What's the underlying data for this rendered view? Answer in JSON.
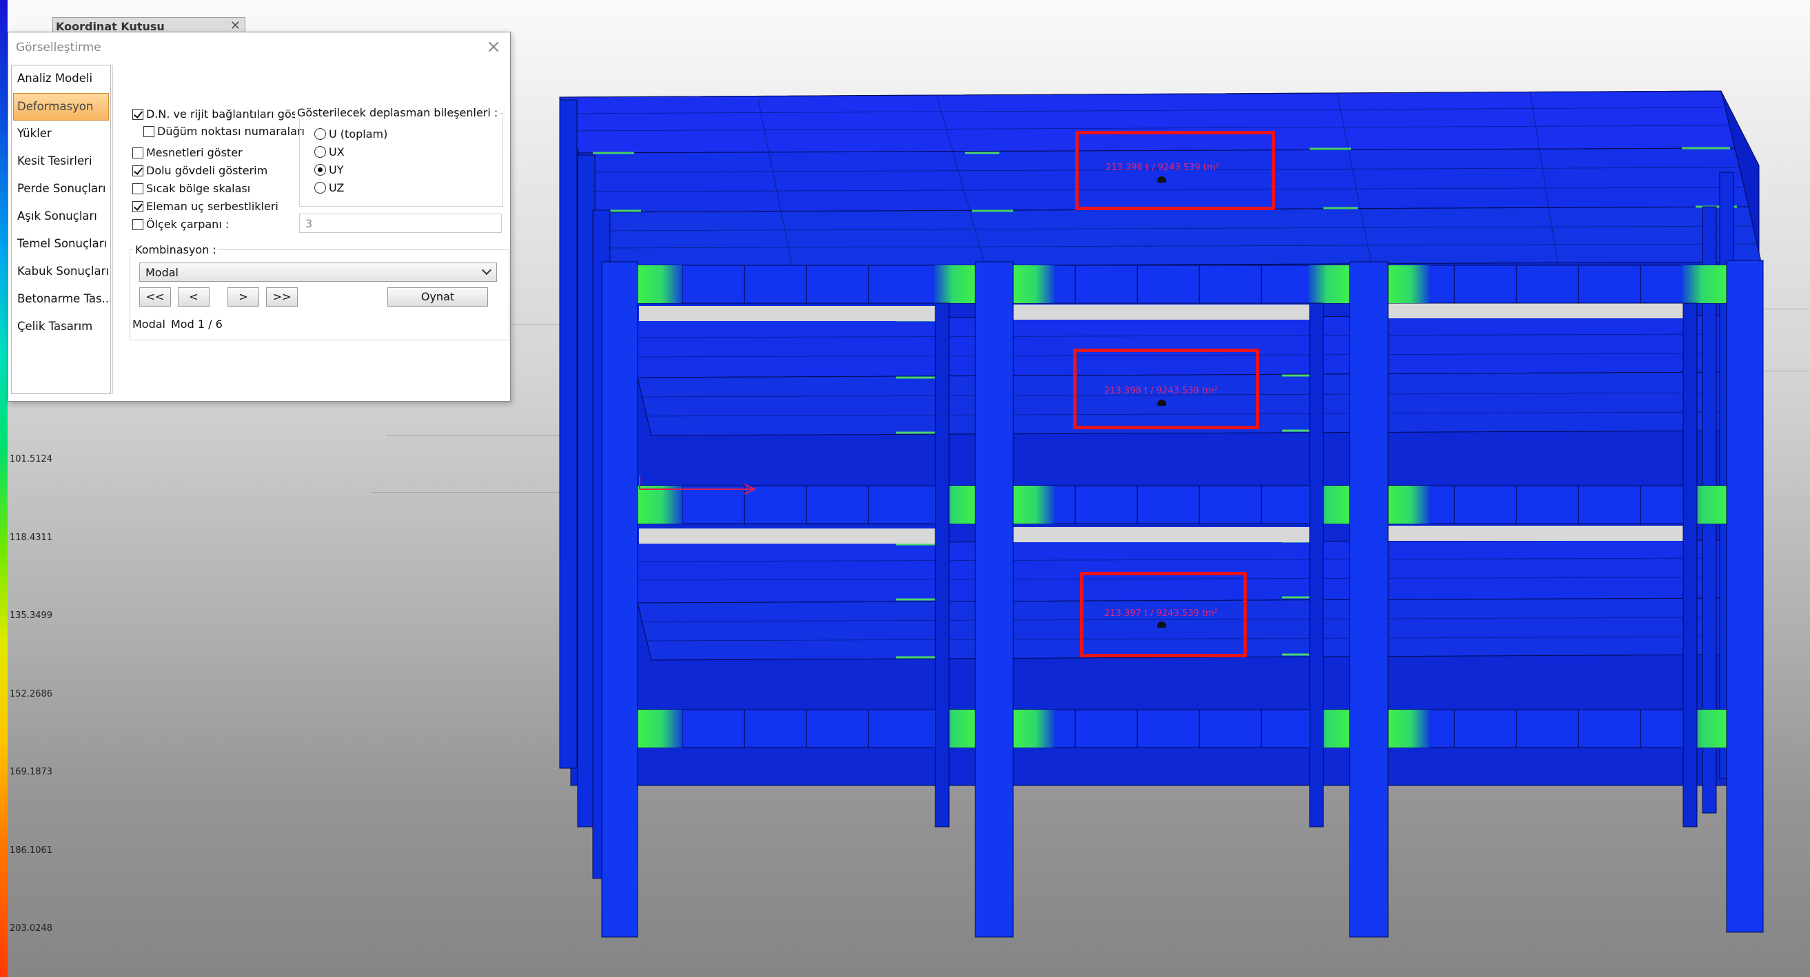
{
  "koordinat_tab": {
    "title": "Koordinat Kutusu"
  },
  "legend": {
    "labels": [
      "101.5124",
      "118.4311",
      "135.3499",
      "152.2686",
      "169.1873",
      "186.1061",
      "203.0248"
    ]
  },
  "dialog": {
    "title": "Görselleştirme",
    "nav": [
      {
        "label": "Analiz Modeli"
      },
      {
        "label": "Deformasyon",
        "active": true
      },
      {
        "label": "Yükler"
      },
      {
        "label": "Kesit Tesirleri"
      },
      {
        "label": "Perde Sonuçları"
      },
      {
        "label": "Aşık Sonuçları"
      },
      {
        "label": "Temel Sonuçları"
      },
      {
        "label": "Kabuk Sonuçları"
      },
      {
        "label": "Betonarme Tas..."
      },
      {
        "label": "Çelik Tasarım"
      }
    ],
    "options": {
      "show_dn_rigid": {
        "label": "D.N. ve rijit bağlantıları göster",
        "checked": true
      },
      "node_numbers": {
        "label": "Düğüm noktası numaraları",
        "checked": false
      },
      "show_supports": {
        "label": "Mesnetleri göster",
        "checked": false
      },
      "solid_view": {
        "label": "Dolu gövdeli gösterim",
        "checked": true
      },
      "hot_zone_scale": {
        "label": "Sıcak bölge skalası",
        "checked": false
      },
      "end_releases": {
        "label": "Eleman uç serbestlikleri",
        "checked": true
      },
      "scale_factor": {
        "label": "Ölçek çarpanı :",
        "checked": false,
        "value": "3"
      }
    },
    "displacement_group": {
      "title": "Gösterilecek deplasman bileşenleri :",
      "options": [
        {
          "label": "U (toplam)",
          "selected": false
        },
        {
          "label": "UX",
          "selected": false
        },
        {
          "label": "UY",
          "selected": true
        },
        {
          "label": "UZ",
          "selected": false
        }
      ]
    },
    "combination": {
      "title": "Kombinasyon :",
      "selected": "Modal",
      "buttons": {
        "first": "<<",
        "prev": "<",
        "next": ">",
        "last": ">>",
        "play": "Oynat"
      },
      "status_name": "Modal",
      "status_mode": "Mod 1 / 6"
    }
  },
  "masses": [
    {
      "text": "213.398 t  /  9243.539 tm²"
    },
    {
      "text": "213.398 t  /  9243.539 tm²"
    },
    {
      "text": "213.397 t  /  9243.539 tm²"
    }
  ],
  "colors": {
    "structure_blue": "#1033e8",
    "structure_dark": "#0a1fc0",
    "joint_green": "#3ef04a",
    "highlight_red": "#e8141c",
    "mass_label": "#e0287a",
    "nav_active": "#f7b45e"
  }
}
